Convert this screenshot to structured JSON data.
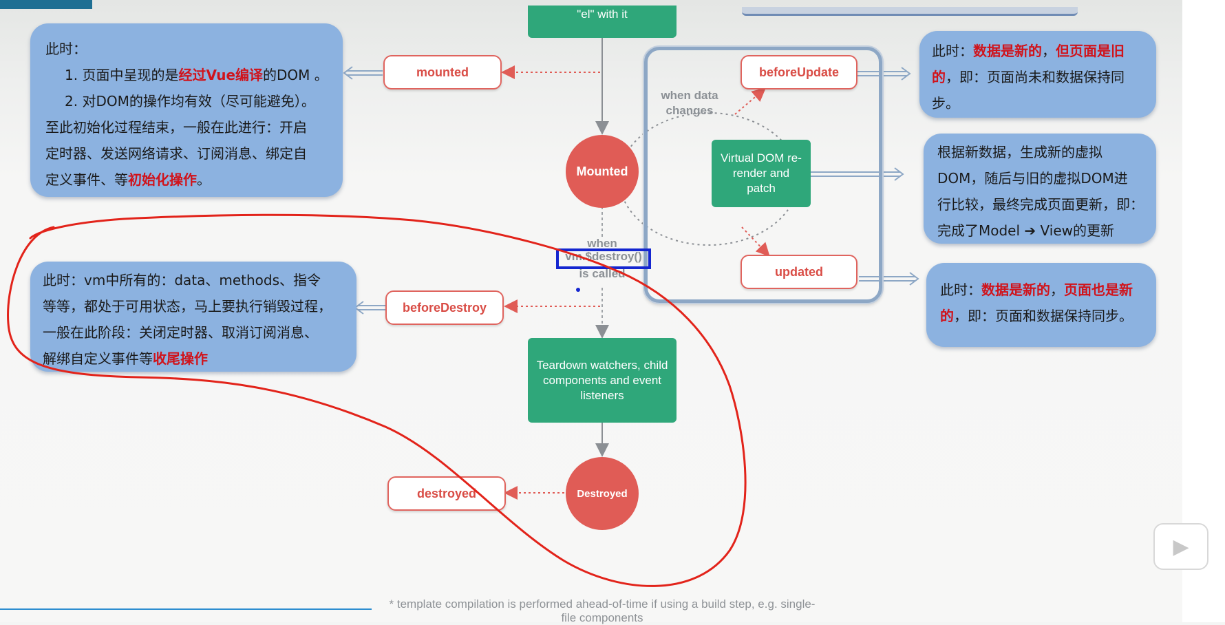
{
  "notes": {
    "mounted": {
      "intro": "此时：",
      "item1_pre": "1. 页面中呈现的是",
      "item1_red": "经过Vue编译",
      "item1_post": "的DOM 。",
      "item2": "2. 对DOM的操作均有效（尽可能避免）。",
      "line3": "至此初始化过程结束，一般在此进行：开启",
      "line4": "定时器、发送网络请求、订阅消息、绑定自",
      "line5_pre": "定义事件、等",
      "line5_red": "初始化操作",
      "line5_post": "。"
    },
    "before_destroy": {
      "line1": "此时：vm中所有的：data、methods、指令",
      "line2": "等等，都处于可用状态，马上要执行销毁过程，",
      "line3": "一般在此阶段：关闭定时器、取消订阅消息、",
      "line4_pre": "解绑自定义事件等",
      "line4_red": "收尾操作"
    },
    "before_update": {
      "pre": "此时：",
      "red1": "数据是新的",
      "mid": "，",
      "red2": "但页面是旧",
      "red3": "的",
      "post1": "，即：页面尚未和数据保持同",
      "post2": "步。"
    },
    "virtual_dom": {
      "line1": "根据新数据，生成新的虚拟",
      "line2": "DOM，随后与旧的虚拟DOM进",
      "line3": "行比较，最终完成页面更新，即：",
      "line4": "完成了Model ➔ View的更新"
    },
    "updated": {
      "pre": "此时：",
      "red1": "数据是新的",
      "mid": "，",
      "red2": "页面也是新",
      "red3": "的",
      "post": "，即：页面和数据保持同步。"
    }
  },
  "diagram": {
    "top_box_text": "\"el\" with it",
    "hooks": {
      "mounted": "mounted",
      "before_update": "beforeUpdate",
      "updated": "updated",
      "before_destroy": "beforeDestroy",
      "destroyed": "destroyed"
    },
    "states": {
      "mounted": "Mounted",
      "destroyed": "Destroyed"
    },
    "virtual_dom_box": "Virtual DOM re-render and patch",
    "when_data_changes": "when data changes",
    "when_label": "when",
    "destroy_call": "vm.$destroy()",
    "is_called": "is called",
    "teardown_box": "Teardown watchers, child components and event listeners"
  },
  "footnote": "* template compilation is performed ahead-of-time if using a build step, e.g. single-file components",
  "colors": {
    "hook_red": "#d94c45",
    "state_circle": "#e05c56",
    "green_box": "#2fa77a",
    "bubble_blue": "#8cb2e0",
    "highlight_red": "#d0131b",
    "annotation_red": "#e2231a",
    "selection_blue": "#1426d0"
  },
  "icons": {
    "player": "play-icon"
  }
}
